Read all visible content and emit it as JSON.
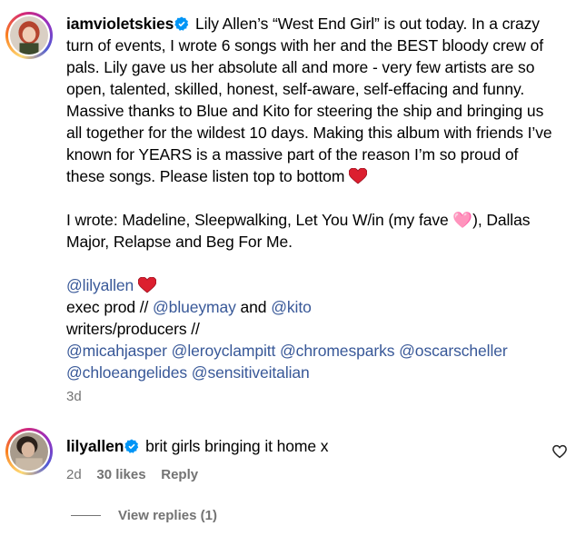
{
  "comment1": {
    "username": "iamvioletskies",
    "line1": "Lily Allen’s “West End Girl” is out today. In a crazy turn of events, I wrote 6 songs with her and the BEST bloody crew of pals. Lily gave us her absolute all and more - very few artists are so open, talented, skilled, honest, self-aware, self-effacing and funny. Massive thanks to Blue and Kito for steering the ship and bringing us all together for the wildest 10 days. Making this album with friends I’ve known for YEARS is a massive part of the reason I’m so proud of these songs. Please listen top to bottom",
    "wrote": "I wrote: Madeline, Sleepwalking, Let You W/in (my fave 🩷), Dallas Major, Relapse and Beg For Me.",
    "mention_lily": "@lilyallen",
    "exec_prefix": "exec prod // ",
    "mention_bluey": "@blueymay",
    "and_text": " and ",
    "mention_kito": "@kito",
    "writers_label": "writers/producers //",
    "mentions_row1": "@micahjasper @leroyclampitt @chromesparks @oscarscheller",
    "mentions_row2": "@chloeangelides @sensitiveitalian",
    "time": "3d"
  },
  "comment2": {
    "username": "lilyallen",
    "text": "brit girls bringing it home x",
    "time": "2d",
    "likes": "30 likes",
    "reply_label": "Reply"
  },
  "view_replies": "View replies (1)",
  "colors": {
    "verified": "#0095f6",
    "mention": "#385898",
    "meta": "#737373",
    "heart": "#e0245e"
  }
}
